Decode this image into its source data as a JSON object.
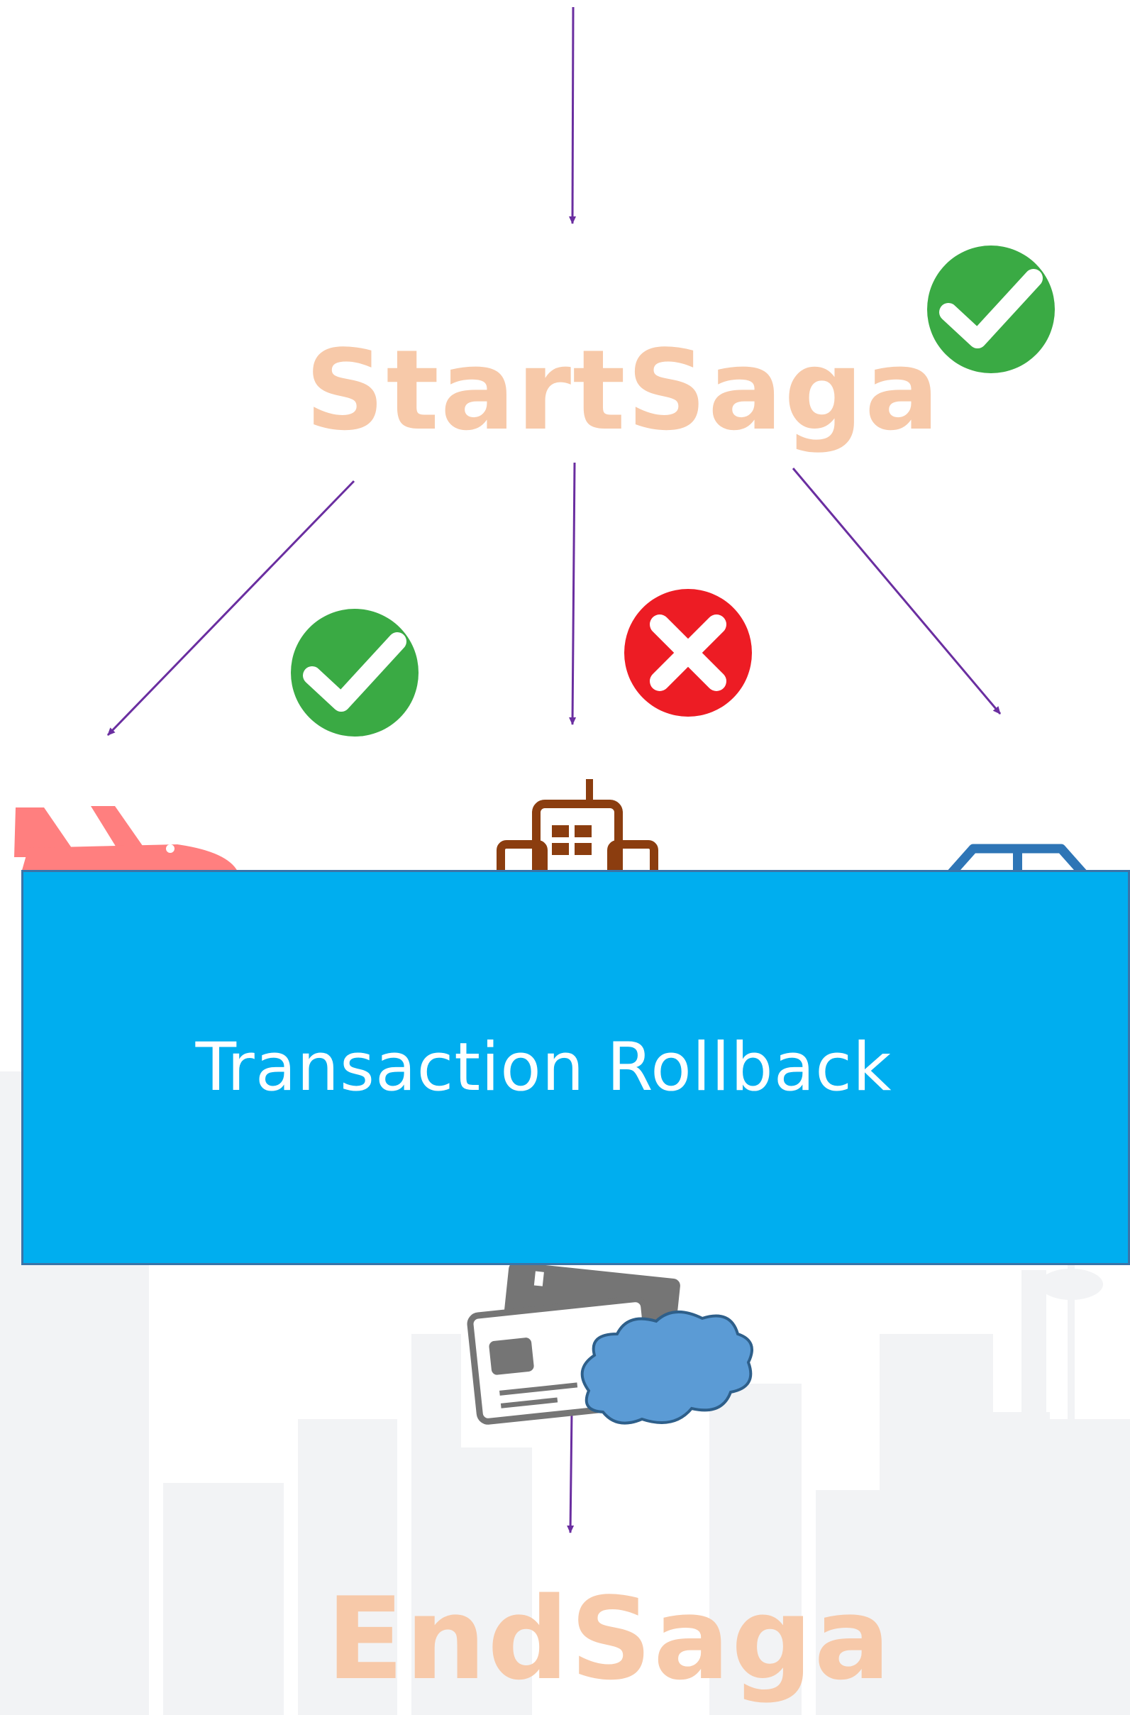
{
  "diagram": {
    "start_label": "StartSaga",
    "end_label": "EndSaga",
    "rollback_label": "Transaction Rollback",
    "colors": {
      "arrow": "#6a2ea0",
      "saga_label": "#f7c9a9",
      "success": "#3aaa44",
      "failure": "#ed1c24",
      "rollback_box": "#00aeef",
      "rollback_border": "#3a74a8",
      "flight": "#ff7f7f",
      "hotel": "#8b3d0f",
      "car": "#2e75b6",
      "card": "#707070",
      "cloud": "#5b9bd5",
      "skyline": "#f2f3f5"
    },
    "icons": [
      "success-check-icon",
      "success-check-icon",
      "failure-cross-icon",
      "airplane-icon",
      "hotel-icon",
      "car-icon",
      "credit-card-icon",
      "cloud-icon"
    ]
  }
}
